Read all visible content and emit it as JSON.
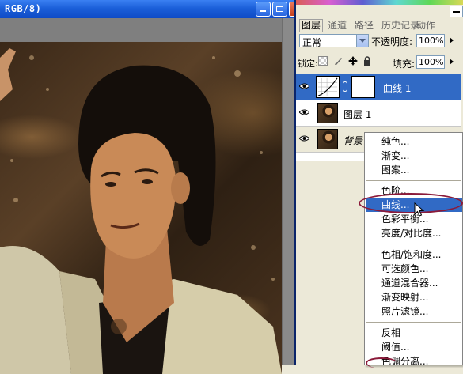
{
  "document": {
    "title": "RGB/8)"
  },
  "panel": {
    "tabs": [
      "图层",
      "通道",
      "路径",
      "历史记录",
      "动作"
    ],
    "active_tab": "图层",
    "blend_mode": "正常",
    "opacity_label": "不透明度:",
    "opacity_value": "100%",
    "lock_label": "锁定:",
    "fill_label": "填充:",
    "fill_value": "100%",
    "layers": [
      {
        "name": "曲线 1",
        "selected": true
      },
      {
        "name": "图层 1",
        "selected": false
      },
      {
        "name": "背景",
        "selected": false
      }
    ]
  },
  "context_menu": {
    "items": [
      "纯色...",
      "渐变...",
      "图案...",
      "色阶...",
      "曲线...",
      "色彩平衡...",
      "亮度/对比度...",
      "色相/饱和度...",
      "可选颜色...",
      "通道混合器...",
      "渐变映射...",
      "照片滤镜...",
      "反相",
      "阈值...",
      "色调分离..."
    ],
    "highlighted": "曲线..."
  },
  "colors": {
    "titlebar": "#1b5fd9",
    "selection": "#316ac5",
    "annotation_ring": "#8b1a3a"
  },
  "icons": [
    "minimize-icon",
    "maximize-icon",
    "eye-icon",
    "link-icon",
    "curves-adjustment-icon",
    "lock-transparent-icon",
    "lock-image-icon",
    "lock-position-icon",
    "lock-all-icon",
    "mouse-cursor-icon"
  ]
}
